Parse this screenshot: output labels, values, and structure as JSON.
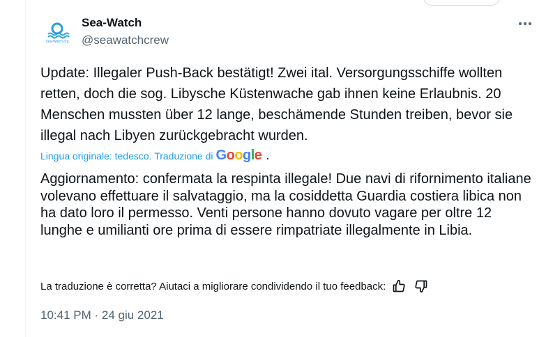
{
  "tweet": {
    "author_name": "Sea-Watch",
    "author_handle": "@seawatchcrew",
    "avatar_text": "Sea-Watch.org",
    "original_text": "Update: Illegaler Push-Back bestätigt! Zwei ital. Versorgungsschiffe wollten retten, doch die sog. Libysche Küstenwache gab ihnen keine Erlaubnis. 20 Menschen mussten über 12 lange, beschämende Stunden treiben, bevor sie illegal nach Libyen zurückgebracht wurden.",
    "translation_note": "Lingua originale: tedesco. Traduzione di",
    "translation_provider": "Google",
    "translated_text": "Aggiornamento: confermata la respinta illegale! Due navi di rifornimento italiane volevano effettuare il salvataggio, ma la cosiddetta Guardia costiera libica non ha dato loro il permesso. Venti persone hanno dovuto vagare per oltre 12 lunghe e umilianti ore prima di essere rimpatriate illegalmente in Libia.",
    "feedback_prompt": "La traduzione è corretta? Aiutaci a migliorare condividendo il tuo feedback:",
    "timestamp": "10:41 PM · 24 giu 2021"
  },
  "icons": {
    "more": "more-options-icon",
    "thumbs_up": "thumbs-up-icon",
    "thumbs_down": "thumbs-down-icon"
  },
  "colors": {
    "text": "#0f1419",
    "secondary": "#536471",
    "link": "#1d9bf0",
    "brand": "#2b9fd9"
  }
}
